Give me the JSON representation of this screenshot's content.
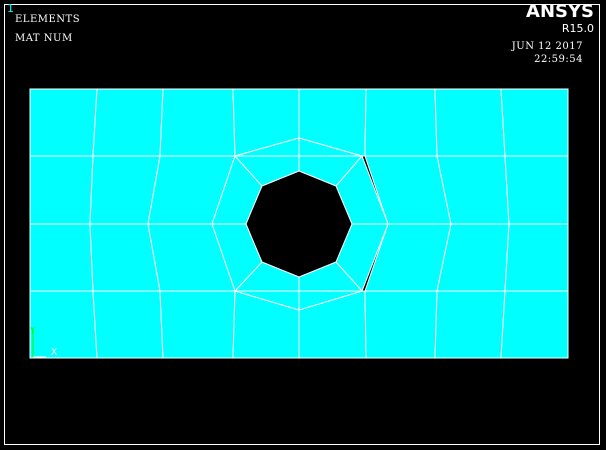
{
  "window": {
    "number": "1"
  },
  "plot": {
    "label_type": "ELEMENTS",
    "label_display": "MAT  NUM"
  },
  "brand": {
    "name": "ANSYS",
    "release": "R15.0"
  },
  "stamp": {
    "date": "JUN 12 2017",
    "time": "22:59:54"
  },
  "triad": {
    "x_label": "X",
    "y_label": "Y",
    "z_label": "Z"
  },
  "colors": {
    "background": "#000000",
    "element_fill": "#00ffff",
    "mesh_line": "#ffffff",
    "hole": "#000000",
    "triad_x": "#ffffff",
    "triad_y": "#00ff00",
    "triad_z": "#ffff00"
  }
}
